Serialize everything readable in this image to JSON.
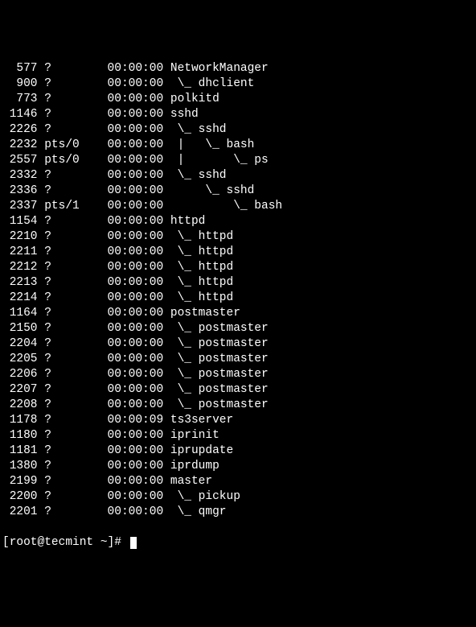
{
  "terminal": {
    "processes": [
      {
        "pid": "  577",
        "tty": "?    ",
        "time": "00:00:00",
        "command": "NetworkManager"
      },
      {
        "pid": "  900",
        "tty": "?    ",
        "time": "00:00:00",
        "command": " \\_ dhclient"
      },
      {
        "pid": "  773",
        "tty": "?    ",
        "time": "00:00:00",
        "command": "polkitd"
      },
      {
        "pid": " 1146",
        "tty": "?    ",
        "time": "00:00:00",
        "command": "sshd"
      },
      {
        "pid": " 2226",
        "tty": "?    ",
        "time": "00:00:00",
        "command": " \\_ sshd"
      },
      {
        "pid": " 2232",
        "tty": "pts/0",
        "time": "00:00:00",
        "command": " |   \\_ bash"
      },
      {
        "pid": " 2557",
        "tty": "pts/0",
        "time": "00:00:00",
        "command": " |       \\_ ps"
      },
      {
        "pid": " 2332",
        "tty": "?    ",
        "time": "00:00:00",
        "command": " \\_ sshd"
      },
      {
        "pid": " 2336",
        "tty": "?    ",
        "time": "00:00:00",
        "command": "     \\_ sshd"
      },
      {
        "pid": " 2337",
        "tty": "pts/1",
        "time": "00:00:00",
        "command": "         \\_ bash"
      },
      {
        "pid": " 1154",
        "tty": "?    ",
        "time": "00:00:00",
        "command": "httpd"
      },
      {
        "pid": " 2210",
        "tty": "?    ",
        "time": "00:00:00",
        "command": " \\_ httpd"
      },
      {
        "pid": " 2211",
        "tty": "?    ",
        "time": "00:00:00",
        "command": " \\_ httpd"
      },
      {
        "pid": " 2212",
        "tty": "?    ",
        "time": "00:00:00",
        "command": " \\_ httpd"
      },
      {
        "pid": " 2213",
        "tty": "?    ",
        "time": "00:00:00",
        "command": " \\_ httpd"
      },
      {
        "pid": " 2214",
        "tty": "?    ",
        "time": "00:00:00",
        "command": " \\_ httpd"
      },
      {
        "pid": " 1164",
        "tty": "?    ",
        "time": "00:00:00",
        "command": "postmaster"
      },
      {
        "pid": " 2150",
        "tty": "?    ",
        "time": "00:00:00",
        "command": " \\_ postmaster"
      },
      {
        "pid": " 2204",
        "tty": "?    ",
        "time": "00:00:00",
        "command": " \\_ postmaster"
      },
      {
        "pid": " 2205",
        "tty": "?    ",
        "time": "00:00:00",
        "command": " \\_ postmaster"
      },
      {
        "pid": " 2206",
        "tty": "?    ",
        "time": "00:00:00",
        "command": " \\_ postmaster"
      },
      {
        "pid": " 2207",
        "tty": "?    ",
        "time": "00:00:00",
        "command": " \\_ postmaster"
      },
      {
        "pid": " 2208",
        "tty": "?    ",
        "time": "00:00:00",
        "command": " \\_ postmaster"
      },
      {
        "pid": " 1178",
        "tty": "?    ",
        "time": "00:00:09",
        "command": "ts3server"
      },
      {
        "pid": " 1180",
        "tty": "?    ",
        "time": "00:00:00",
        "command": "iprinit"
      },
      {
        "pid": " 1181",
        "tty": "?    ",
        "time": "00:00:00",
        "command": "iprupdate"
      },
      {
        "pid": " 1380",
        "tty": "?    ",
        "time": "00:00:00",
        "command": "iprdump"
      },
      {
        "pid": " 2199",
        "tty": "?    ",
        "time": "00:00:00",
        "command": "master"
      },
      {
        "pid": " 2200",
        "tty": "?    ",
        "time": "00:00:00",
        "command": " \\_ pickup"
      },
      {
        "pid": " 2201",
        "tty": "?    ",
        "time": "00:00:00",
        "command": " \\_ qmgr"
      }
    ],
    "prompt": "[root@tecmint ~]# "
  }
}
